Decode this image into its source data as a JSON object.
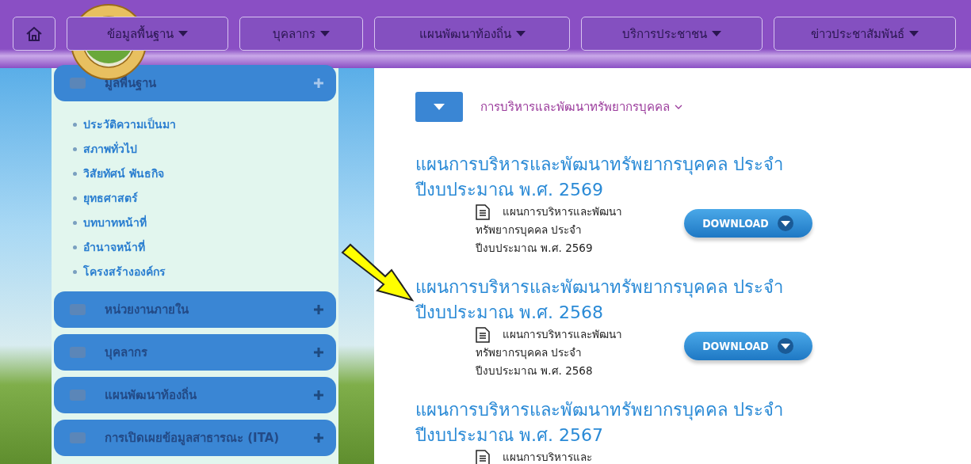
{
  "nav": {
    "items": [
      {
        "label": "ข้อมูลพื้นฐาน"
      },
      {
        "label": "บุคลากร"
      },
      {
        "label": "แผนพัฒนาท้องถิ่น"
      },
      {
        "label": "บริการประชาชน"
      },
      {
        "label": "ข่าวประชาสัมพันธ์"
      }
    ]
  },
  "sidebar": {
    "sections": [
      {
        "label": "มูลพื้นฐาน",
        "expanded": true,
        "children": [
          "ประวัติความเป็นมา",
          "สภาพทั่วไป",
          "วิสัยทัศน์ พันธกิจ",
          "ยุทธศาสตร์",
          "บทบาทหน้าที่",
          "อำนาจหน้าที่",
          "โครงสร้างองค์กร"
        ]
      },
      {
        "label": "หน่วยงานภายใน",
        "expanded": false
      },
      {
        "label": "บุคลากร",
        "expanded": false
      },
      {
        "label": "แผนพัฒนาท้องถิ่น",
        "expanded": false
      },
      {
        "label": "การเปิดเผยข้อมูลสาธารณะ (ITA)",
        "expanded": false
      }
    ]
  },
  "content": {
    "category": "การบริหารและพัฒนาทรัพยากรบุคคล",
    "documents": [
      {
        "title": "แผนการบริหารและพัฒนาทรัพยากรบุคคล ประจำปีงบประมาณ พ.ศ. 2569",
        "file": "แผนการบริหารและพัฒนาทรัพยากรบุคคล ประจำปีงบประมาณ พ.ศ. 2569",
        "download": "DOWNLOAD"
      },
      {
        "title": "แผนการบริหารและพัฒนาทรัพยากรบุคคล ประจำปีงบประมาณ พ.ศ. 2568",
        "file": "แผนการบริหารและพัฒนาทรัพยากรบุคคล ประจำปีงบประมาณ พ.ศ. 2568",
        "download": "DOWNLOAD"
      },
      {
        "title": "แผนการบริหารและพัฒนาทรัพยากรบุคคล ประจำปีงบประมาณ พ.ศ. 2567",
        "file": "แผนการบริหารและ"
      }
    ]
  }
}
